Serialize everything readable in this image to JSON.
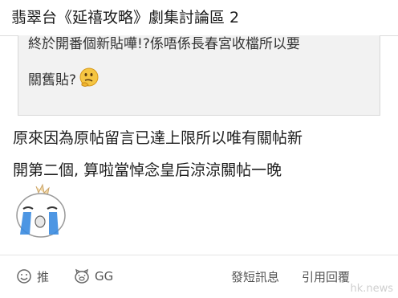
{
  "header": {
    "title": "翡翠台《延禧攻略》劇集討論區 2"
  },
  "quote": {
    "line1": "終於開番個新貼嘩!?係唔係長春宮收檔所以要",
    "line2": "關舊貼?"
  },
  "post": {
    "line1": "原來因為原帖留言已達上限所以唯有關帖新",
    "line2": "開第二個, 算啦當悼念皇后涼涼關帖一晚"
  },
  "actions": {
    "like_label": "推",
    "gg_label": "GG",
    "pm_label": "發短訊息",
    "reply_label": "引用回覆"
  },
  "watermark": "hk.news",
  "icons": {
    "like": "smiley-face-icon",
    "gg": "pig-face-icon",
    "quote_emoji": "thinking-face-icon",
    "sticker": "crying-onion-sticker"
  },
  "colors": {
    "quote_bg": "#f2f2f2",
    "emoji_yellow": "#f5c542",
    "tear_blue": "#3a8be0"
  }
}
